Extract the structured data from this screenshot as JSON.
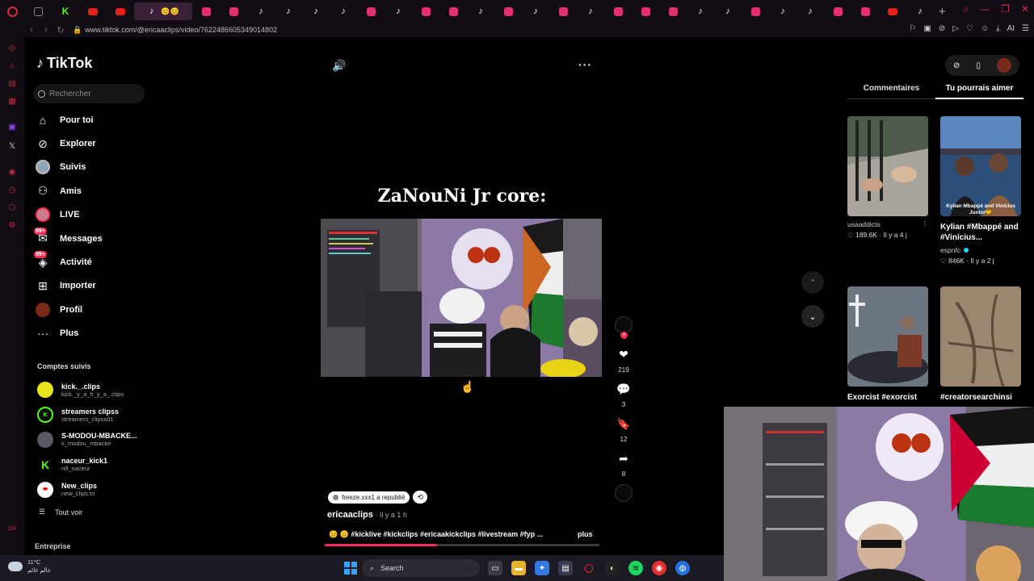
{
  "browser": {
    "url": "www.tiktok.com/@ericaaclips/video/7622486605349014802",
    "tabs": [
      {
        "icon": "gen"
      },
      {
        "icon": "kick"
      },
      {
        "icon": "yt"
      },
      {
        "icon": "yt"
      },
      {
        "icon": "tiktok",
        "active": true
      },
      {
        "icon": "insta"
      },
      {
        "icon": "insta"
      },
      {
        "icon": "tiktok"
      },
      {
        "icon": "tiktok"
      },
      {
        "icon": "tiktok"
      },
      {
        "icon": "tiktok"
      },
      {
        "icon": "insta"
      },
      {
        "icon": "tiktok"
      },
      {
        "icon": "insta"
      },
      {
        "icon": "insta"
      },
      {
        "icon": "tiktok"
      },
      {
        "icon": "insta"
      },
      {
        "icon": "tiktok"
      },
      {
        "icon": "insta"
      },
      {
        "icon": "tiktok"
      },
      {
        "icon": "insta"
      },
      {
        "icon": "insta"
      },
      {
        "icon": "insta"
      },
      {
        "icon": "tiktok"
      },
      {
        "icon": "tiktok"
      },
      {
        "icon": "insta"
      },
      {
        "icon": "tiktok"
      },
      {
        "icon": "tiktok"
      },
      {
        "icon": "insta"
      },
      {
        "icon": "insta"
      },
      {
        "icon": "yt"
      },
      {
        "icon": "tiktok"
      }
    ]
  },
  "tiktok": {
    "brand": "TikTok",
    "search_placeholder": "Rechercher",
    "nav": [
      {
        "label": "Pour toi",
        "icon": "home-icon"
      },
      {
        "label": "Explorer",
        "icon": "compass-icon"
      },
      {
        "label": "Suivis",
        "icon": "following-avatar-icon"
      },
      {
        "label": "Amis",
        "icon": "friends-icon"
      },
      {
        "label": "LIVE",
        "icon": "live-icon"
      },
      {
        "label": "Messages",
        "icon": "messages-icon",
        "badge": "99+"
      },
      {
        "label": "Activité",
        "icon": "activity-icon",
        "badge": "99+"
      },
      {
        "label": "Importer",
        "icon": "upload-icon"
      },
      {
        "label": "Profil",
        "icon": "profile-icon"
      },
      {
        "label": "Plus",
        "icon": "more-icon"
      }
    ],
    "followed_title": "Comptes suivis",
    "followed": [
      {
        "name": "kick._.clips",
        "handle": "kick._y_a_h_y_a_.clips",
        "color": "#e8e61a"
      },
      {
        "name": "streamers clipss",
        "handle": "streamers_clipss01",
        "color": "#0b0b0b"
      },
      {
        "name": "S-MODOU-MBACKE...",
        "handle": "s_modou_mbacke",
        "color": "#5a5a66"
      },
      {
        "name": "naceur_kick1",
        "handle": "n9_naceur",
        "color": "#000000"
      },
      {
        "name": "New_clips",
        "handle": "new_clips.tn",
        "color": "#ffffff"
      }
    ],
    "see_all": "Tout voir",
    "enterprise": "Entreprise"
  },
  "video": {
    "title": "ZaNouNi Jr core:",
    "repost_text": "freeze.xxx1 a republié",
    "author": "ericaaclips",
    "time": " · Il y a 1 h",
    "caption": "😊 😊 #kicklive #kickclips #ericaakickclips #livestream #fyp ...",
    "more": "plus",
    "progress": 0.41,
    "likes": "219",
    "comments": "3",
    "saves": "12",
    "shares": "8"
  },
  "right": {
    "tabs": [
      "Commentaires",
      "Tu pourrais aimer"
    ],
    "active_tab": 1,
    "cards": [
      {
        "title": "",
        "author": "usaaddicts",
        "likes": "189.6K",
        "time": "Il y a 4 j",
        "verified": false
      },
      {
        "title": "Kylian #Mbappé and #Vinícius...",
        "author": "espnfc",
        "likes": "846K",
        "time": "Il y a 2 j",
        "verified": true
      },
      {
        "title": "Exorcist #exorcist",
        "author": "",
        "likes": "",
        "time": "",
        "verified": false
      },
      {
        "title": "#creatorsearchinsi",
        "author": "",
        "likes": "",
        "time": "",
        "verified": false
      }
    ],
    "thumb_overlay": "Kylian Mbappé and Vinícius Junior🤝"
  },
  "taskbar": {
    "temp": "11°C",
    "weather_text": "عالم غائم",
    "search": "Search"
  },
  "colors": {
    "accent": "#fe2c55",
    "opera_red": "#e0243b",
    "kick_green": "#53fc18"
  }
}
